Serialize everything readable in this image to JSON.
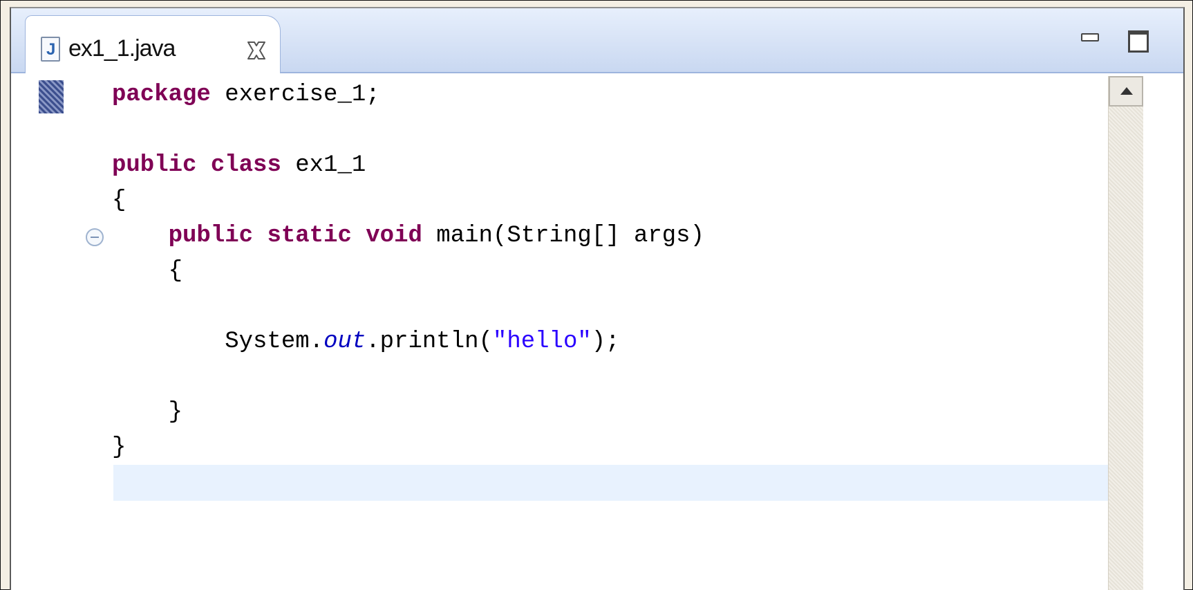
{
  "tab": {
    "file_icon_glyph": "J",
    "label": "ex1_1.java",
    "icon": "java-file-icon"
  },
  "window_controls": [
    "minimize-icon",
    "maximize-icon"
  ],
  "code": {
    "lines": [
      [
        {
          "t": "package",
          "c": "kw"
        },
        {
          "t": " exercise_1;"
        }
      ],
      [],
      [
        {
          "t": "public",
          "c": "kw"
        },
        {
          "t": " "
        },
        {
          "t": "class",
          "c": "kw"
        },
        {
          "t": " ex1_1"
        }
      ],
      [
        {
          "t": "{"
        }
      ],
      [
        {
          "t": "    "
        },
        {
          "t": "public",
          "c": "kw"
        },
        {
          "t": " "
        },
        {
          "t": "static",
          "c": "kw"
        },
        {
          "t": " "
        },
        {
          "t": "void",
          "c": "kw"
        },
        {
          "t": " main(String[] args)"
        }
      ],
      [
        {
          "t": "    {"
        }
      ],
      [],
      [
        {
          "t": "        System."
        },
        {
          "t": "out",
          "c": "field"
        },
        {
          "t": ".println("
        },
        {
          "t": "\"hello\"",
          "c": "str"
        },
        {
          "t": ");"
        }
      ],
      [],
      [
        {
          "t": "    }"
        }
      ],
      [
        {
          "t": "}"
        }
      ],
      []
    ]
  },
  "colors": {
    "keyword": "#7f0055",
    "string": "#2a00ff",
    "field": "#0000c0",
    "current_line": "#e8f2fe",
    "tab_strip": "#c9d8f1"
  }
}
